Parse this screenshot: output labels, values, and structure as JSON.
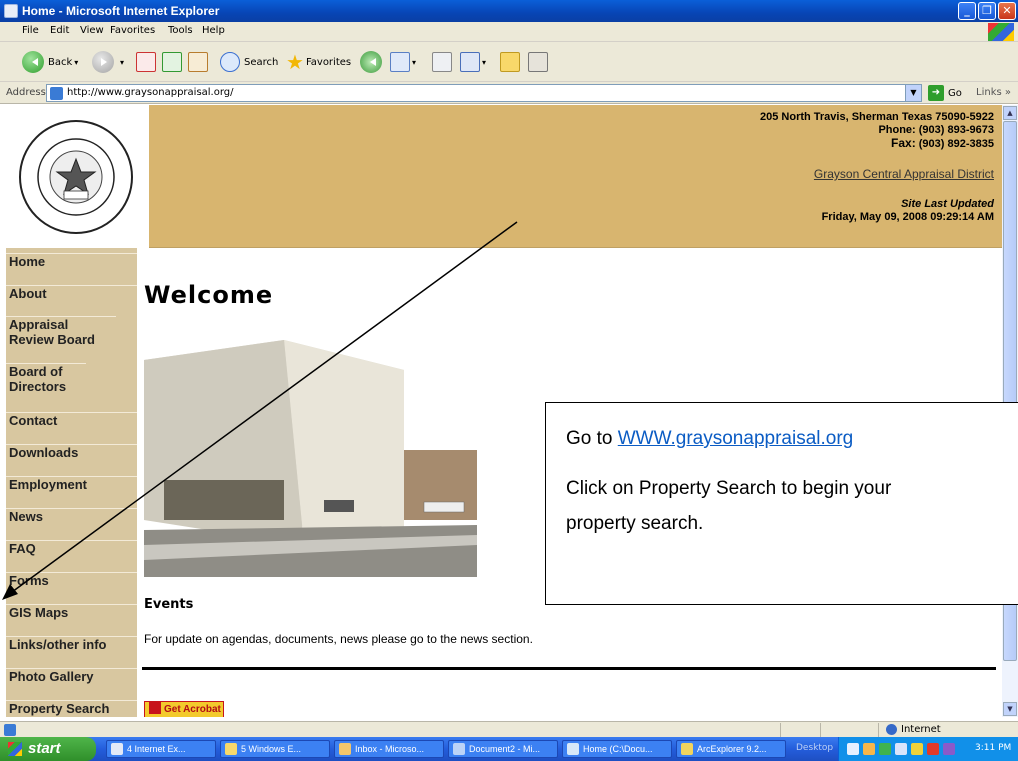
{
  "window": {
    "title": "Home - Microsoft Internet Explorer"
  },
  "menu": [
    "File",
    "Edit",
    "View",
    "Favorites",
    "Tools",
    "Help"
  ],
  "toolbar": {
    "back": "Back",
    "search": "Search",
    "favorites": "Favorites"
  },
  "address": {
    "label": "Address",
    "url": "http://www.graysonappraisal.org/",
    "go": "Go",
    "links": "Links"
  },
  "header": {
    "address": "205 North Travis, Sherman Texas 75090-5922",
    "phone": "Phone: (903) 893-9673",
    "fax": "Fax:",
    "fax_number": "(903) 892-3835",
    "site_link": "Grayson Central Appraisal District",
    "updated_label": "Site Last Updated",
    "updated_date": "Friday, May 09, 2008 09:29:14 AM"
  },
  "logo": {
    "top": "APPRAISAL DISTRICT",
    "bottom": "G C A D",
    "inner": "GRAYSON COUNTY TEXAS",
    "est": "Est. 1846"
  },
  "nav": [
    {
      "label": "Home"
    },
    {
      "label": "About"
    },
    {
      "label": "Appraisal Review Board"
    },
    {
      "label": "Board of Directors"
    },
    {
      "label": "Contact"
    },
    {
      "label": "Downloads"
    },
    {
      "label": "Employment"
    },
    {
      "label": "News"
    },
    {
      "label": "FAQ"
    },
    {
      "label": "Forms"
    },
    {
      "label": "GIS Maps"
    },
    {
      "label": "Links/other info"
    },
    {
      "label": "Photo Gallery"
    },
    {
      "label": "Property Search"
    }
  ],
  "main": {
    "heading": "Welcome",
    "events_heading": "Events",
    "events_text": "For update on agendas, documents, news please go to the news section.",
    "acrobat": "Get Acrobat"
  },
  "callout": {
    "go_to": "Go to ",
    "link": "WWW.graysonappraisal.org",
    "line2": "Click on Property Search to begin your",
    "line3": "property search."
  },
  "status": {
    "zone": "Internet"
  },
  "taskbar": {
    "start": "start",
    "tasks": [
      "4 Internet Ex...",
      "5 Windows E...",
      "Inbox - Microso...",
      "Document2 - Mi...",
      "Home (C:\\Docu...",
      "ArcExplorer 9.2..."
    ],
    "desktop": "Desktop",
    "clock": "3:11 PM"
  }
}
